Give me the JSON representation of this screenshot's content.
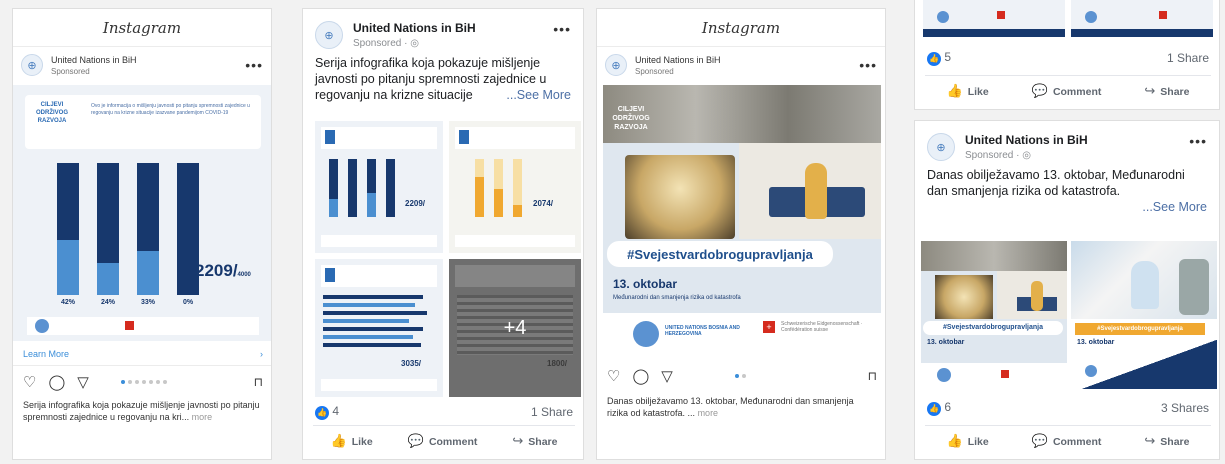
{
  "instagram_1": {
    "app_title": "Instagram",
    "account": "United Nations in BiH",
    "sponsored": "Sponsored",
    "menu": "•••",
    "logo_text": "CILJEVI ODRŽIVOG RAZVOJA",
    "intro_text": "Ovo je informacija o mišljenju javnosti po pitanju spremnosti zajednice u regovanju na krizne situacije izazvane pandemijom COVID-19",
    "bars": [
      {
        "pct": "42%",
        "fraction": 0.42
      },
      {
        "pct": "24%",
        "fraction": 0.24
      },
      {
        "pct": "33%",
        "fraction": 0.33
      },
      {
        "pct": "0%",
        "fraction": 0.0
      }
    ],
    "big_number": "2209/",
    "big_number_total": "4000",
    "learn_more": "Learn More",
    "learn_more_arrow": "›",
    "caption": "Serija infografika koja pokazuje mišljenje javnosti po pitanju spremnosti zajednice u regovanju na kri...",
    "caption_more": "more"
  },
  "facebook_1": {
    "account": "United Nations in BiH",
    "sponsored": "Sponsored · ",
    "menu": "•••",
    "text": "Serija infografika koja pokazuje mišljenje javnosti po pitanju spremnosti zajednice u regovanju na krizne situacije",
    "see_more": "...See More",
    "tile1_number": "2209/",
    "tile2_number": "2074/",
    "tile3_number": "3035/",
    "tile4_number": "1800/",
    "overlay_count": "+4",
    "likes": "4",
    "shares": "1 Share",
    "like_label": "Like",
    "comment_label": "Comment",
    "share_label": "Share"
  },
  "instagram_2": {
    "app_title": "Instagram",
    "account": "United Nations in BiH",
    "sponsored": "Sponsored",
    "menu": "•••",
    "logo_text": "CILJEVI ODRŽIVOG RAZVOJA",
    "hashtag": "#Svejestvardobrogupravljanja",
    "date_title": "13. oktobar",
    "subtitle": "Međunarodni dan smanjenja rizika od katastrofa",
    "un_org": "UNITED NATIONS BOSNIA AND HERZEGOVINA",
    "swiss_org": "Schweizerische Eidgenossenschaft · Confédération suisse",
    "caption": "Danas obilježavamo 13. oktobar, Međunarodni dan smanjenja rizika od katastrofa. ...",
    "caption_more": "more"
  },
  "facebook_top": {
    "likes": "5",
    "shares": "1 Share",
    "like_label": "Like",
    "comment_label": "Comment",
    "share_label": "Share"
  },
  "facebook_2": {
    "account": "United Nations in BiH",
    "sponsored": "Sponsored · ",
    "menu": "•••",
    "text": "Danas obilježavamo 13. oktobar, Međunarodni dan smanjenja rizika od katastrofa.",
    "see_more": "...See More",
    "hashtag": "#Svejestvardobrogupravljanja",
    "date_title": "13. oktobar",
    "likes": "6",
    "shares": "3 Shares",
    "like_label": "Like",
    "comment_label": "Comment",
    "share_label": "Share"
  },
  "colors": {
    "un_blue": "#17386d",
    "bar_blue": "#4b8fd0",
    "fb_blue": "#1877f2",
    "accent_orange": "#f0a830"
  }
}
